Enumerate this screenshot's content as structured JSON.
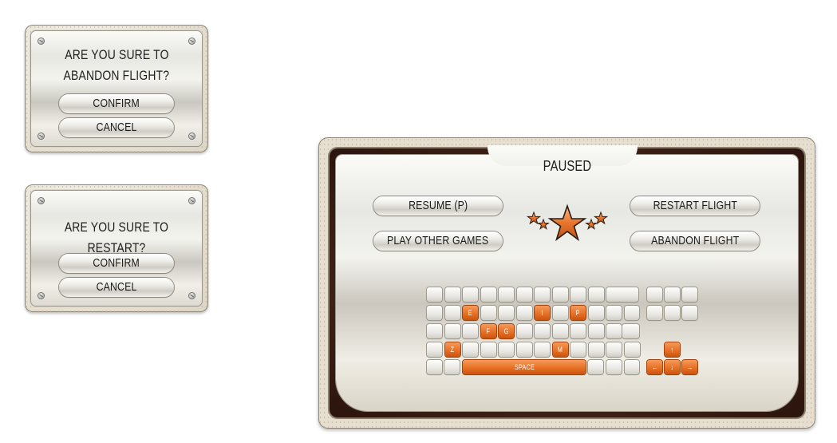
{
  "abandon_dialog": {
    "question_line1": "ARE YOU SURE TO",
    "question_line2": "ABANDON FLIGHT?",
    "confirm_label": "CONFIRM",
    "cancel_label": "CANCEL"
  },
  "restart_dialog": {
    "question": "ARE YOU SURE TO RESTART?",
    "confirm_label": "CONFIRM",
    "cancel_label": "CANCEL"
  },
  "pause_menu": {
    "title": "PAUSED",
    "resume_label": "RESUME (P)",
    "restart_label": "RESTART FLIGHT",
    "other_games_label": "PLAY OTHER GAMES",
    "abandon_label": "ABANDON FLIGHT",
    "emblem_icon": "star-rank-icon"
  },
  "keyboard": {
    "highlighted_keys": [
      "E",
      "I",
      "P",
      "F",
      "G",
      "Z",
      "M"
    ],
    "space_label": "SPACE",
    "arrow_keys": [
      "↑",
      "←",
      "↓",
      "→"
    ]
  },
  "colors": {
    "key_highlight": "#e66d22",
    "frame_brown": "#3c1f15"
  }
}
